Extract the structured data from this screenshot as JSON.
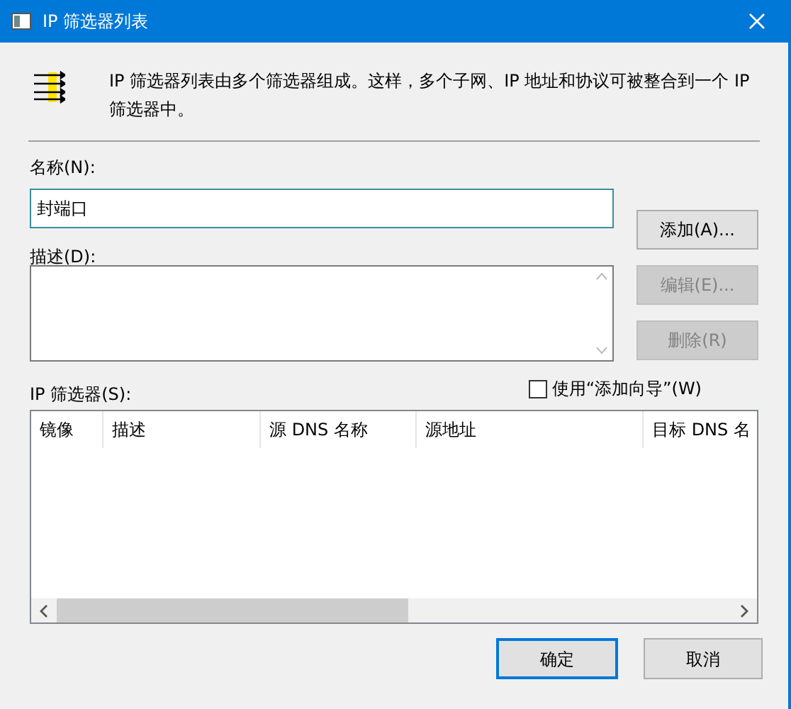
{
  "window": {
    "title": "IP 筛选器列表"
  },
  "intro": "IP 筛选器列表由多个筛选器组成。这样，多个子网、IP 地址和协议可被整合到一个 IP 筛选器中。",
  "name_field": {
    "label": "名称(N):",
    "value": "封端口"
  },
  "description_field": {
    "label": "描述(D):"
  },
  "side_buttons": [
    {
      "label": "添加(A)...",
      "disabled": false
    },
    {
      "label": "编辑(E)...",
      "disabled": true
    },
    {
      "label": "删除(R)",
      "disabled": true
    }
  ],
  "filters_label": "IP 筛选器(S):",
  "wizard_checkbox": {
    "label": "使用“添加向导”(W)",
    "checked": false
  },
  "table": {
    "columns": [
      "镜像",
      "描述",
      "源 DNS 名称",
      "源地址",
      "目标 DNS 名"
    ]
  },
  "buttons": [
    {
      "label": "确定",
      "default": true
    },
    {
      "label": "取消",
      "default": false
    }
  ]
}
